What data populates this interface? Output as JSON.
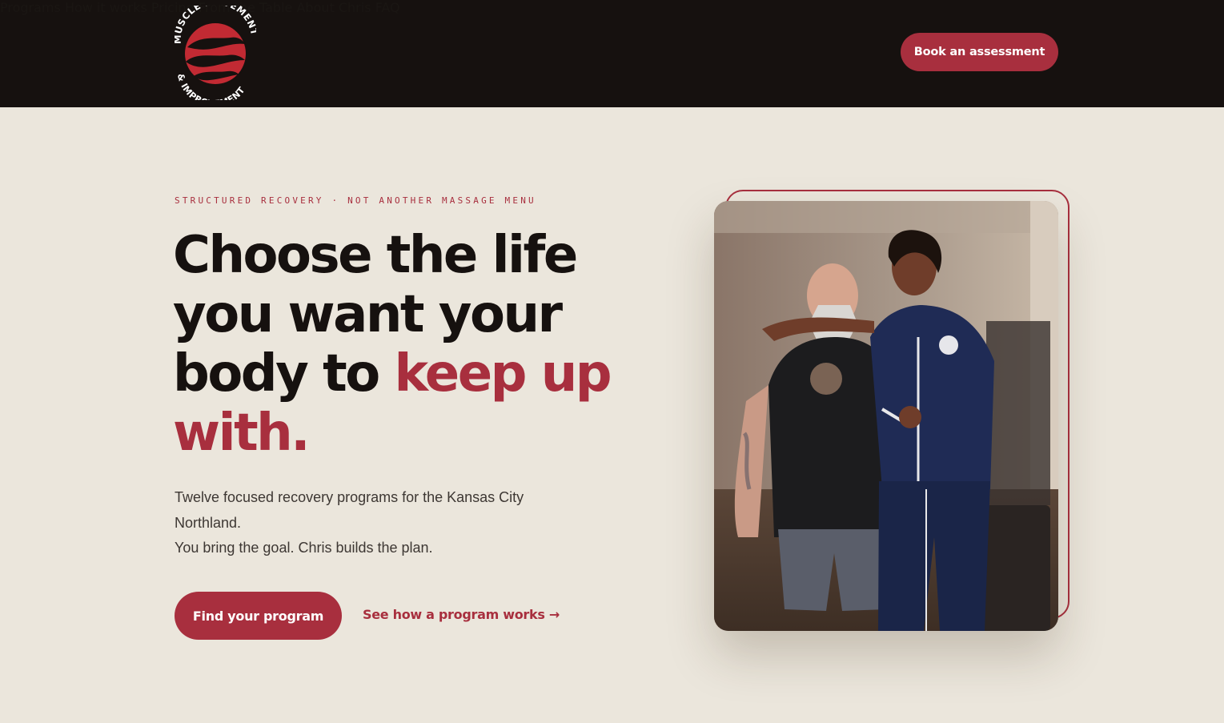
{
  "brand": {
    "logo_text_top": "MUSCLE MOVEMENT",
    "logo_text_bottom": "& IMPROVEMENT"
  },
  "nav": {
    "items": [
      {
        "label": "Programs"
      },
      {
        "label": "How it works"
      },
      {
        "label": "Pricing"
      },
      {
        "label": "From the Table"
      },
      {
        "label": "About Chris"
      },
      {
        "label": "FAQ"
      }
    ],
    "cta_label": "Book an assessment"
  },
  "hero": {
    "eyebrow": "STRUCTURED RECOVERY · NOT ANOTHER MASSAGE MENU",
    "headline_part1": "Choose the life you want your body to ",
    "headline_accent": "keep up with.",
    "sub_line1": "Twelve focused recovery programs for the Kansas City Northland.",
    "sub_line2": "You bring the goal. Chris builds the plan.",
    "primary_cta": "Find your program",
    "secondary_cta": "See how a program works →"
  },
  "colors": {
    "accent": "#a82f3e",
    "dark": "#16110f",
    "background": "#ebe6dc"
  }
}
